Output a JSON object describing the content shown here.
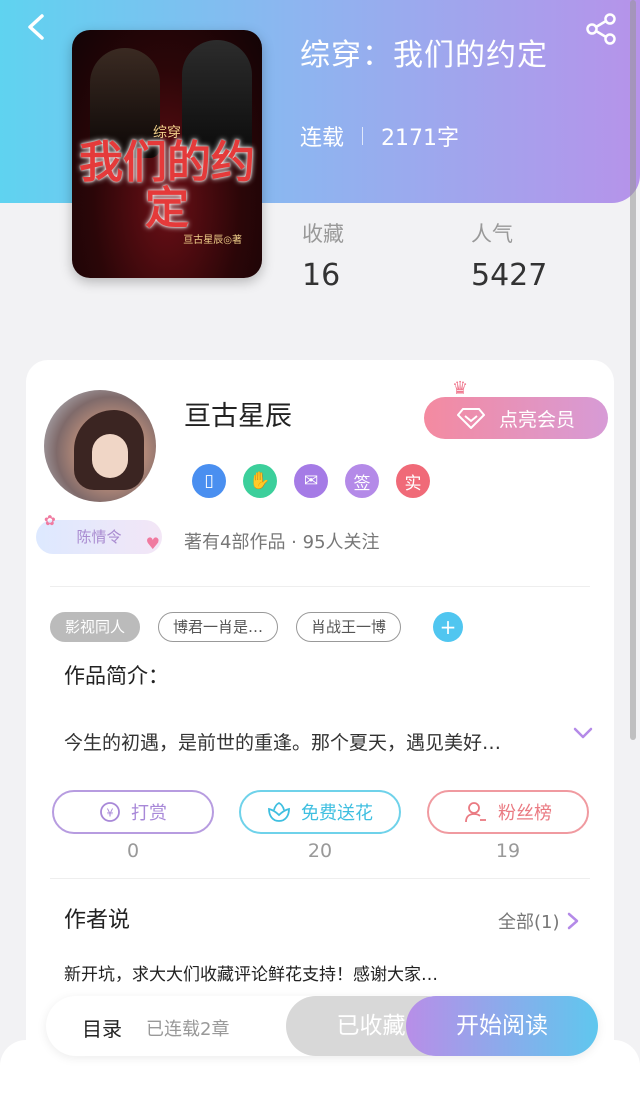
{
  "header": {
    "book_title": "综穿：我们的约定",
    "status": "连载",
    "word_count": "2171字",
    "cover": {
      "subtitle": "综穿",
      "title": "我们的约定",
      "author": "亘古星辰◎著"
    }
  },
  "stats": [
    {
      "label": "收藏",
      "value": "16"
    },
    {
      "label": "人气",
      "value": "5427"
    }
  ],
  "author": {
    "name": "亘古星辰",
    "badge_tag": "陈情令",
    "vip_label": "点亮会员",
    "icon_badges": [
      {
        "icon": "phone-icon",
        "text": "",
        "color": "#4a8ff0"
      },
      {
        "icon": "handshake-icon",
        "text": "",
        "color": "#3ccf9b"
      },
      {
        "icon": "envelope-icon",
        "text": "",
        "color": "#a57be6"
      },
      {
        "icon": "sign-icon",
        "text": "签",
        "color": "#b48ae8"
      },
      {
        "icon": "verified-icon",
        "text": "实",
        "color": "#f06a78"
      }
    ],
    "works_summary": "著有4部作品 · 95人关注"
  },
  "tags": [
    "影视同人",
    "博君一肖是…",
    "肖战王一博"
  ],
  "intro": {
    "heading": "作品简介：",
    "text": "今生的初遇，是前世的重逢。那个夏天，遇见美好…"
  },
  "actions": [
    {
      "label": "打赏",
      "count": "0",
      "icon": "coin-icon",
      "color": "#a888d8"
    },
    {
      "label": "免费送花",
      "count": "20",
      "icon": "flower-icon",
      "color": "#4fc7e2"
    },
    {
      "label": "粉丝榜",
      "count": "19",
      "icon": "user-rank-icon",
      "color": "#ee7b82"
    }
  ],
  "author_says": {
    "heading": "作者说",
    "all_label": "全部(1)",
    "text": "新开坑，求大大们收藏评论鲜花支持！感谢大家…"
  },
  "bottom_bar": {
    "toc_label": "目录",
    "toc_sub": "已连载2章",
    "favorited_label": "已收藏",
    "read_label": "开始阅读"
  }
}
